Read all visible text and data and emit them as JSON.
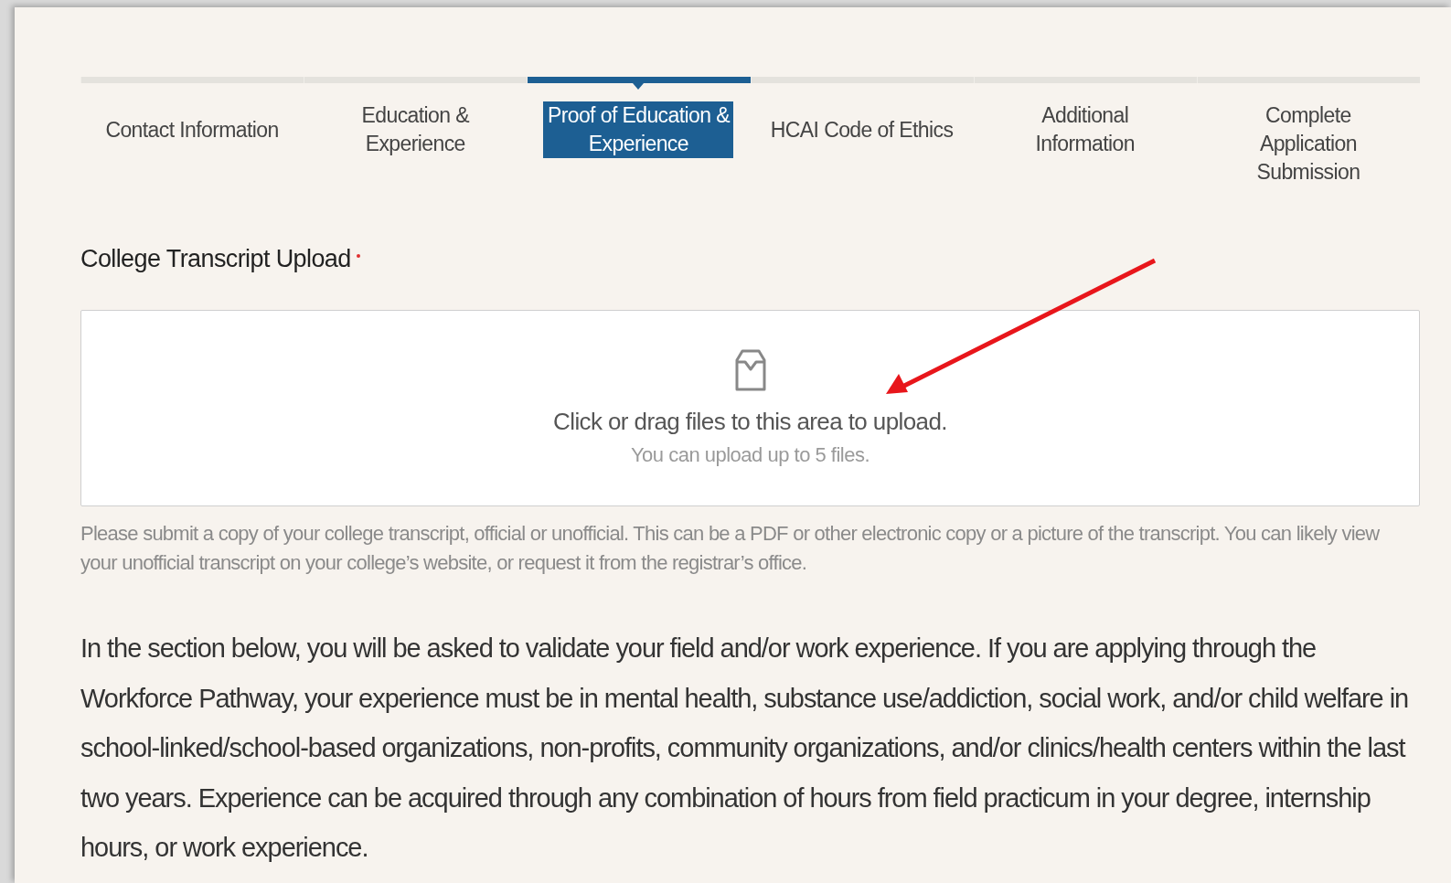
{
  "steps": [
    {
      "label": "Contact Information",
      "selected": false
    },
    {
      "label": "Education & Experience",
      "selected": false
    },
    {
      "label": "Proof of Education & Experience",
      "selected": true
    },
    {
      "label": "HCAI Code of Ethics",
      "selected": false
    },
    {
      "label": "Additional Information",
      "selected": false
    },
    {
      "label": "Complete Application Submission",
      "selected": false
    }
  ],
  "upload": {
    "label": "College Transcript Upload",
    "required": true,
    "prompt": "Click or drag files to this area to upload.",
    "hint": "You can upload up to 5 files.",
    "help": "Please submit a copy of your college transcript, official or unofficial. This can be a PDF or other electronic copy or a picture of the transcript. You can likely view your unofficial transcript on your college’s website, or request it from the registrar’s office."
  },
  "intro": "In the section below, you will be asked to validate your field and/or work experience. If you are applying through the Workforce Pathway, your experience must be in mental health, substance use/addiction, social work, and/or child welfare in school-linked/school-based organizations, non-profits, community organizations, and/or clinics/health centers within the last two years. Experience can be acquired through any combination of hours from field practicum in your degree, internship hours, or work experience."
}
